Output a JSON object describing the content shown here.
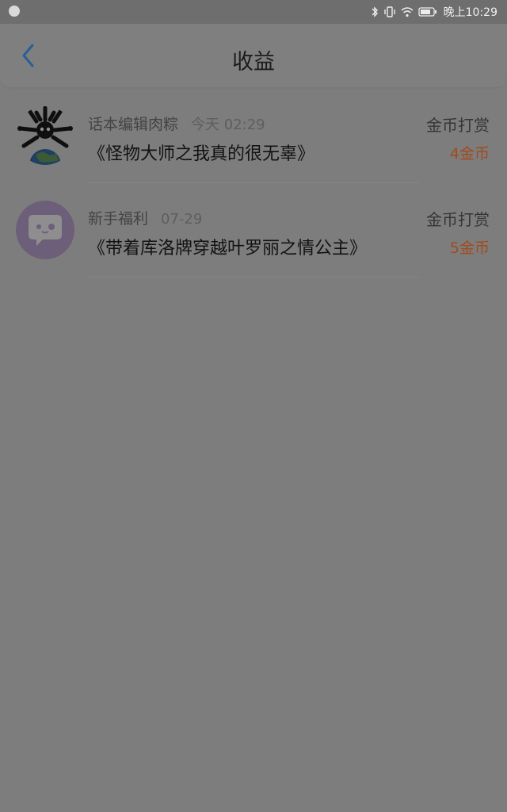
{
  "status_bar": {
    "time": "晚上10:29",
    "icons": [
      "moon-icon",
      "bluetooth-icon",
      "vibrate-icon",
      "wifi-icon",
      "battery-icon"
    ]
  },
  "header": {
    "title": "收益",
    "back_icon": "chevron-left-icon"
  },
  "records": [
    {
      "name": "话本编辑肉粽",
      "time": "今天 02:29",
      "book": "《怪物大师之我真的很无辜》",
      "type": "金币打赏",
      "amount": "4金币",
      "avatar": "globe-character-avatar"
    },
    {
      "name": "新手福利",
      "time": "07-29",
      "book": "《带着库洛牌穿越叶罗丽之情公主》",
      "type": "金币打赏",
      "amount": "5金币",
      "avatar": "chat-bubble-avatar"
    }
  ],
  "colors": {
    "overlay_background": "#7d7d7d",
    "accent_blue": "#2a5f93",
    "amount_orange": "#a24a1d"
  }
}
